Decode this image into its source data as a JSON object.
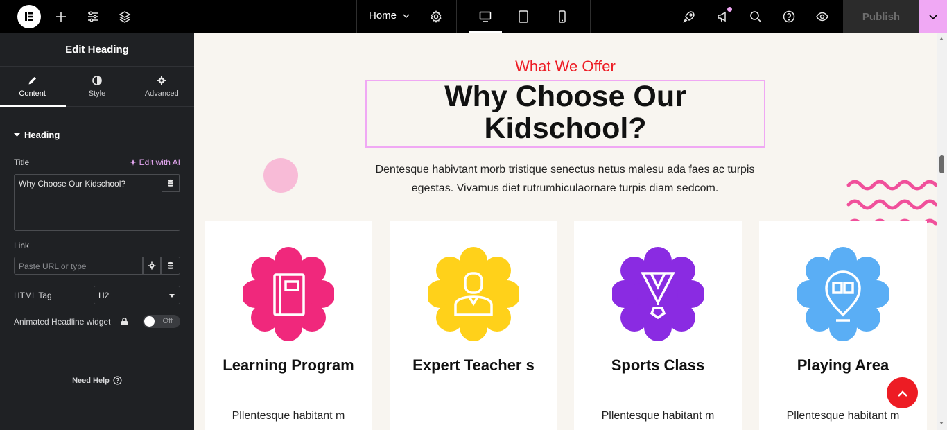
{
  "topbar": {
    "page_name": "Home",
    "publish_label": "Publish"
  },
  "panel": {
    "title": "Edit Heading",
    "tabs": [
      {
        "label": "Content",
        "icon": "pencil-icon"
      },
      {
        "label": "Style",
        "icon": "contrast-icon"
      },
      {
        "label": "Advanced",
        "icon": "gear-icon"
      }
    ],
    "section_title": "Heading",
    "title_label": "Title",
    "ai_link": "Edit with AI",
    "title_value": "Why Choose Our Kidschool?",
    "link_label": "Link",
    "link_placeholder": "Paste URL or type",
    "html_tag_label": "HTML Tag",
    "html_tag_value": "H2",
    "animated_label": "Animated Headline widget",
    "toggle_label": "Off",
    "need_help": "Need Help"
  },
  "preview": {
    "subtitle": "What We Offer",
    "heading": "Why Choose Our Kidschool?",
    "description": "Dentesque habivtant morb tristique senectus netus malesu ada faes ac turpis egestas. Vivamus diet rutrumhiculaornare turpis diam sedcom.",
    "cards": [
      {
        "title": "Learning Program",
        "text": "Pllentesque habitant m",
        "color": "#f0287c",
        "icon": "book-icon"
      },
      {
        "title": "Expert Teacher s",
        "text": "",
        "color": "#ffd11a",
        "icon": "teacher-icon"
      },
      {
        "title": "Sports Class",
        "text": "Pllentesque habitant m",
        "color": "#8a2be2",
        "icon": "medal-icon"
      },
      {
        "title": "Playing Area",
        "text": "Pllentesque habitant m",
        "color": "#5aaef5",
        "icon": "location-book-icon"
      }
    ]
  },
  "colors": {
    "accent_red": "#ed1c24",
    "selection_pink": "#f0a8f4"
  }
}
